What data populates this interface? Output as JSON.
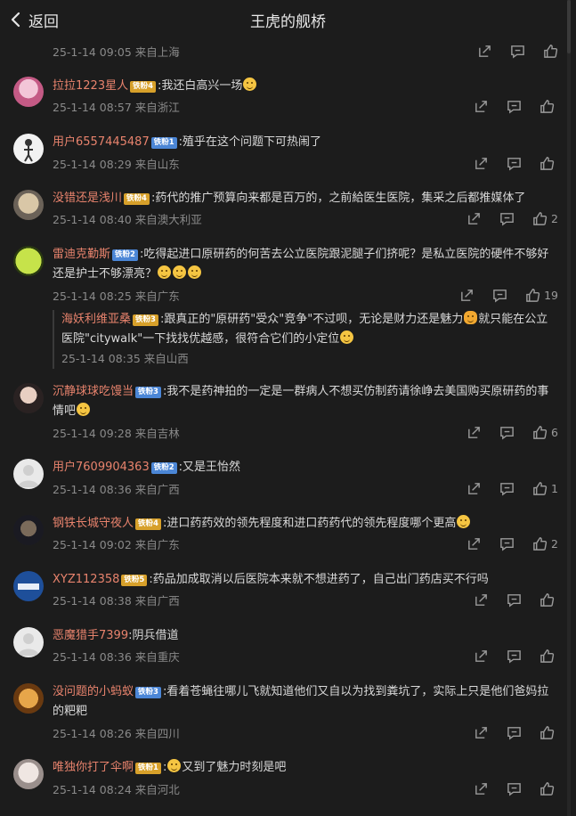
{
  "header": {
    "back_label": "返回",
    "title": "王虎的舰桥"
  },
  "top_meta": "25-1-14 09:05 来自上海",
  "comments": [
    {
      "user": "拉拉1223星人",
      "badge": "铁粉4",
      "text": ":我还白高兴一场",
      "meta": "25-1-14 08:57 来自浙江",
      "likes": ""
    },
    {
      "user": "用户6557445487",
      "badge": "铁粉1",
      "text": ":殖乎在这个问题下可热闹了",
      "meta": "25-1-14 08:29 来自山东",
      "likes": ""
    },
    {
      "user": "没错还是浅川",
      "badge": "铁粉4",
      "text": ":药代的推广预算向来都是百万的，之前給医生医院，集采之后都推媒体了",
      "meta": "25-1-14 08:40 来自澳大利亚",
      "likes": "2"
    },
    {
      "user": "雷迪克勤斯",
      "badge": "铁粉2",
      "text": ":吃得起进口原研药的何苦去公立医院跟泥腿子们挤呢？是私立医院的硬件不够好还是护士不够漂亮？",
      "meta": "25-1-14 08:25 来自广东",
      "likes": "19"
    },
    {
      "user": "海妖利维亚桑",
      "badge": "铁粉3",
      "text": ":跟真正的\"原研药\"受众\"竞争\"不过呗，无论是财力还是魅力",
      "text2": "就只能在公立医院\"citywalk\"一下找找优越感，很符合它们的小定位",
      "meta": "25-1-14 08:35 来自山西",
      "likes": ""
    },
    {
      "user": "沉静球球吃馒当",
      "badge": "铁粉3",
      "text": ":我不是药神拍的一定是一群病人不想买仿制药请徐峥去美国购买原研药的事情吧",
      "meta": "25-1-14 09:28 来自吉林",
      "likes": "6"
    },
    {
      "user": "用户7609904363",
      "badge": "铁粉2",
      "text": ":又是王怡然",
      "meta": "25-1-14 08:36 来自广西",
      "likes": "1"
    },
    {
      "user": "钢铁长城守夜人",
      "badge": "铁粉4",
      "text": ":进口药药效的领先程度和进口药药代的领先程度哪个更高",
      "meta": "25-1-14 09:02 来自广东",
      "likes": "2"
    },
    {
      "user": "XYZ112358",
      "badge": "铁粉5",
      "text": ":药品加成取消以后医院本来就不想进药了，自己出门药店买不行吗",
      "meta": "25-1-14 08:38 来自广西",
      "likes": ""
    },
    {
      "user": "恶魔猎手7399",
      "badge": "",
      "text": ":阴兵借道",
      "meta": "25-1-14 08:36 来自重庆",
      "likes": ""
    },
    {
      "user": "没问题的小蚂蚁",
      "badge": "铁粉3",
      "text": ":看着苍蝇往哪儿飞就知道他们又自以为找到粪坑了，实际上只是他们爸妈拉的粑粑",
      "meta": "25-1-14 08:26 来自四川",
      "likes": ""
    },
    {
      "user": "唯独你打了伞啊",
      "badge": "铁粉1",
      "text": "又到了魅力时刻是吧",
      "meta": "25-1-14 08:24 来自河北",
      "likes": ""
    }
  ],
  "icons": {
    "share": "share-icon",
    "comment": "comment-icon",
    "like": "thumbs-up-icon"
  },
  "colors": {
    "background": "#1c1c1c",
    "username": "#e8836d",
    "badge_gold": "#d7a02a",
    "badge_blue": "#4b86d6"
  }
}
